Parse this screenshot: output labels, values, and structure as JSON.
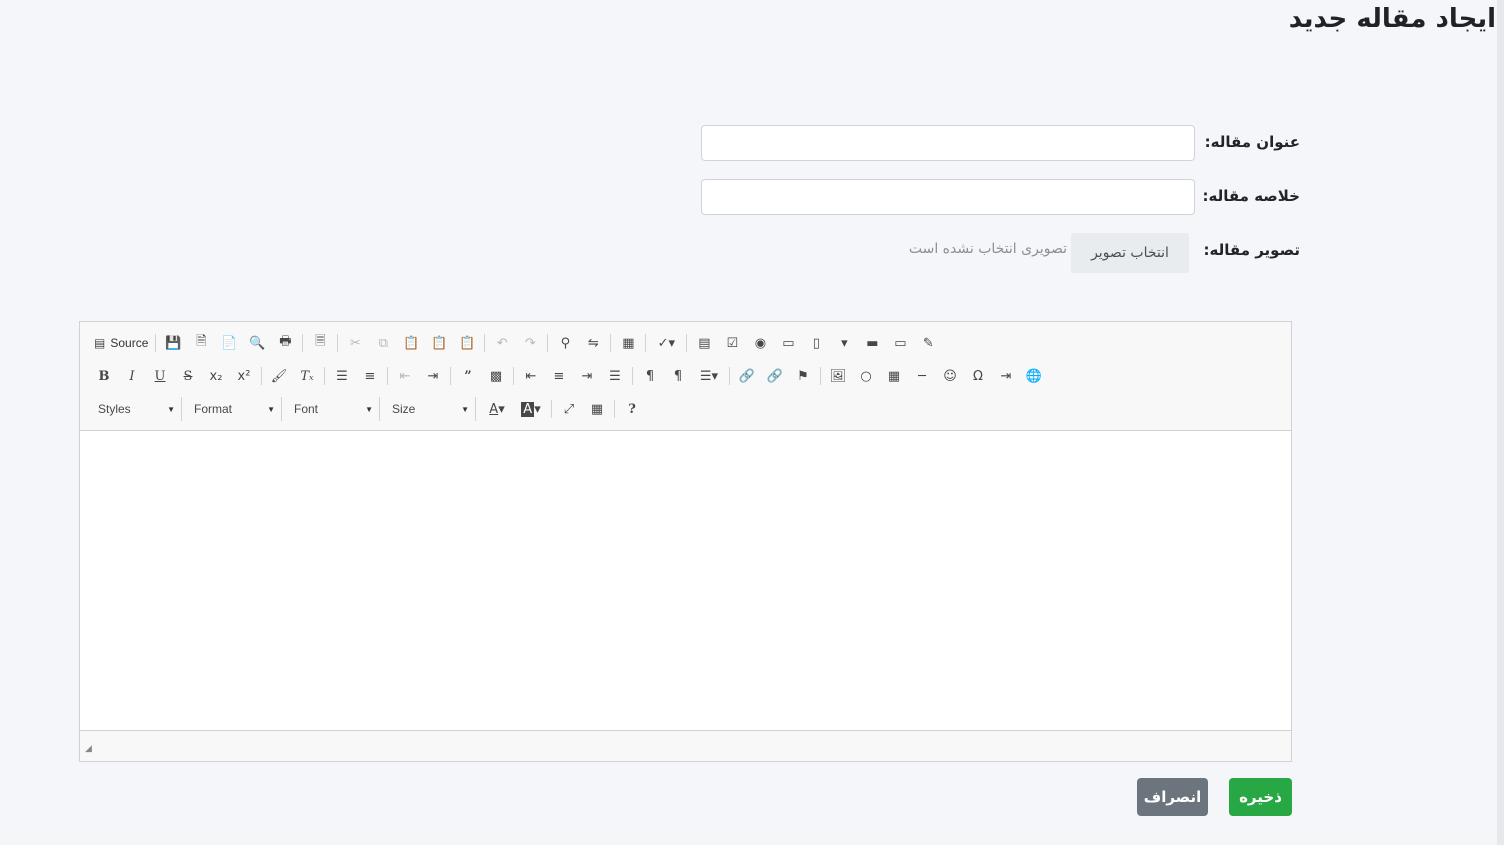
{
  "page": {
    "title": "ایجاد مقاله جدید"
  },
  "form": {
    "title_label": "عنوان مقاله:",
    "title_value": "",
    "summary_label": "خلاصه مقاله:",
    "summary_value": "",
    "image_label": "تصویر مقاله:",
    "image_button": "انتخاب تصویر",
    "image_status": "تصویری انتخاب نشده است"
  },
  "editor": {
    "source_label": "Source",
    "styles_label": "Styles",
    "format_label": "Format",
    "font_label": "Font",
    "size_label": "Size"
  },
  "actions": {
    "save_label": "ذخیره",
    "cancel_label": "انصراف"
  },
  "colors": {
    "save": "#28a745",
    "cancel": "#6c757d",
    "background": "#f4f6f9"
  }
}
